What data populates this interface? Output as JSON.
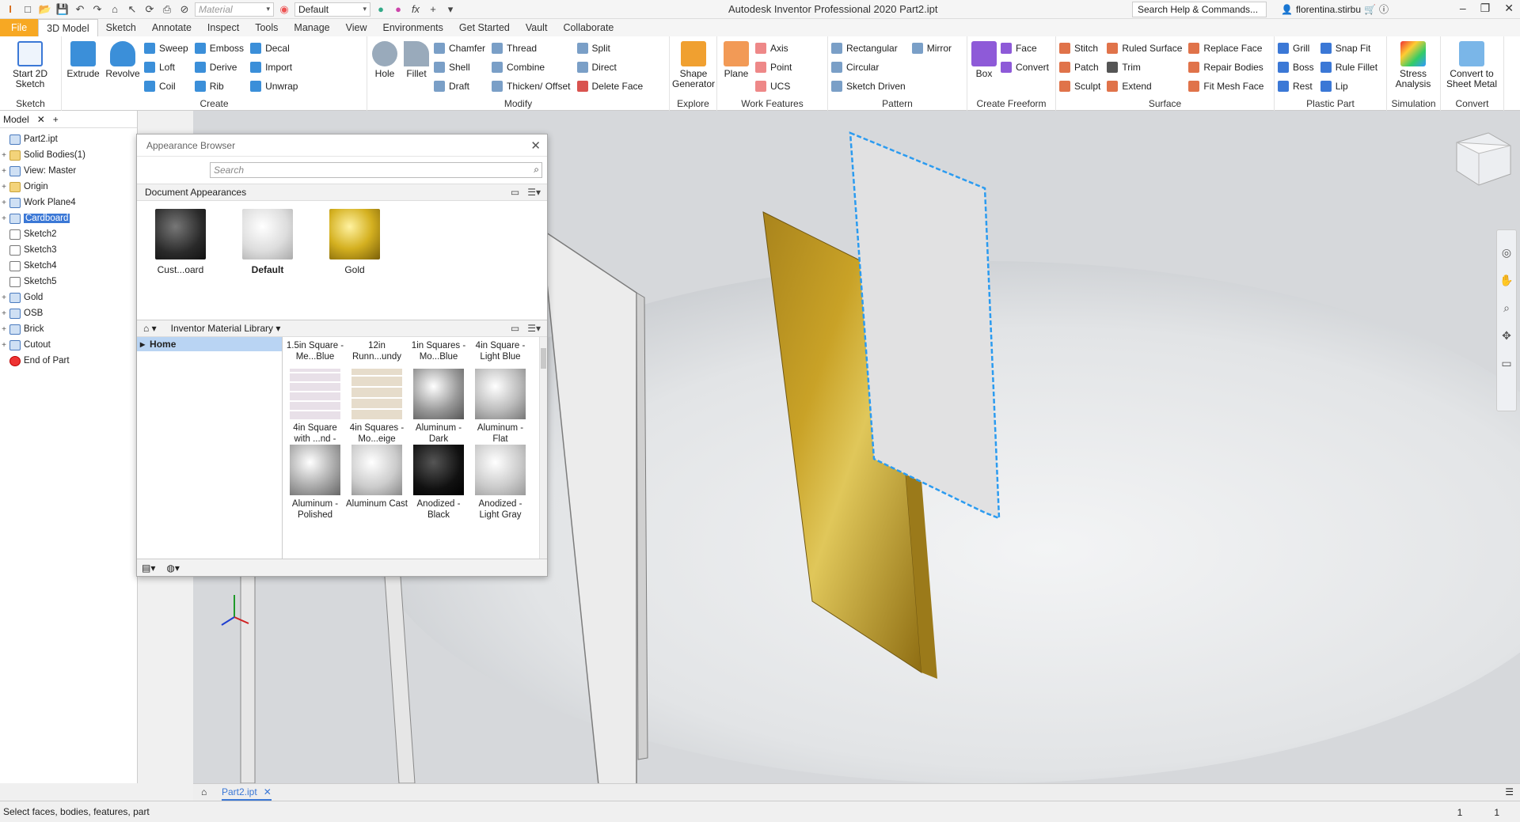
{
  "titlebar": {
    "material_combo": "Material",
    "appearance_combo": "Default",
    "app_title": "Autodesk Inventor Professional 2020   Part2.ipt",
    "search_help": "Search Help & Commands...",
    "user": "florentina.stirbu"
  },
  "menu": {
    "tabs": [
      "File",
      "3D Model",
      "Sketch",
      "Annotate",
      "Inspect",
      "Tools",
      "Manage",
      "View",
      "Environments",
      "Get Started",
      "Vault",
      "Collaborate"
    ]
  },
  "ribbon": {
    "sketch": {
      "big": "Start 2D Sketch",
      "label": "Sketch"
    },
    "create": {
      "big1": "Extrude",
      "big2": "Revolve",
      "col1": [
        "Sweep",
        "Loft",
        "Coil"
      ],
      "col2": [
        "Emboss",
        "Derive",
        "Rib"
      ],
      "col3": [
        "Decal",
        "Import",
        "Unwrap"
      ],
      "label": "Create"
    },
    "modify": {
      "big1": "Hole",
      "big2": "Fillet",
      "col1": [
        "Chamfer",
        "Shell",
        "Draft"
      ],
      "col2": [
        "Thread",
        "Combine",
        "Thicken/ Offset"
      ],
      "col3": [
        "Split",
        "Direct",
        "Delete Face"
      ],
      "label": "Modify"
    },
    "explore": {
      "big": "Shape Generator",
      "label": "Explore"
    },
    "work": {
      "big": "Plane",
      "col1": [
        "Axis",
        "Point",
        "UCS"
      ],
      "label": "Work Features"
    },
    "pattern": {
      "col1": [
        "Rectangular",
        "Circular",
        "Sketch Driven"
      ],
      "col2": [
        "Mirror"
      ],
      "label": "Pattern"
    },
    "freeform": {
      "big": "Box",
      "col1": [
        "Face",
        "Convert"
      ],
      "label": "Create Freeform"
    },
    "surface": {
      "col1": [
        "Stitch",
        "Patch",
        "Sculpt"
      ],
      "col2": [
        "Ruled Surface",
        "Trim",
        "Extend"
      ],
      "col3": [
        "Replace Face",
        "Repair Bodies",
        "Fit Mesh Face"
      ],
      "label": "Surface"
    },
    "plastic": {
      "col1": [
        "Grill",
        "Boss",
        "Rest"
      ],
      "col2": [
        "Snap Fit",
        "Rule Fillet",
        "Lip"
      ],
      "label": "Plastic Part"
    },
    "simulation": {
      "big": "Stress Analysis",
      "label": "Simulation"
    },
    "convert": {
      "big": "Convert to Sheet Metal",
      "label": "Convert"
    }
  },
  "model_browser": {
    "tab": "Model",
    "nodes": [
      {
        "label": "Part2.ipt",
        "type": "part",
        "exp": ""
      },
      {
        "label": "Solid Bodies(1)",
        "type": "folder",
        "exp": "+"
      },
      {
        "label": "View: Master",
        "type": "view",
        "exp": "+"
      },
      {
        "label": "Origin",
        "type": "folder",
        "exp": "+"
      },
      {
        "label": "Work Plane4",
        "type": "plane",
        "exp": "+"
      },
      {
        "label": "Cardboard",
        "type": "feature",
        "exp": "+"
      },
      {
        "label": "Sketch2",
        "type": "sketch",
        "exp": ""
      },
      {
        "label": "Sketch3",
        "type": "sketch",
        "exp": ""
      },
      {
        "label": "Sketch4",
        "type": "sketch",
        "exp": ""
      },
      {
        "label": "Sketch5",
        "type": "sketch",
        "exp": ""
      },
      {
        "label": "Gold",
        "type": "feature",
        "exp": "+"
      },
      {
        "label": "OSB",
        "type": "feature",
        "exp": "+"
      },
      {
        "label": "Brick",
        "type": "feature",
        "exp": "+"
      },
      {
        "label": "Cutout",
        "type": "feature",
        "exp": "+"
      },
      {
        "label": "End of Part",
        "type": "end",
        "exp": ""
      }
    ]
  },
  "appearance_browser": {
    "title": "Appearance Browser",
    "search_placeholder": "Search",
    "doc_section": "Document Appearances",
    "doc_items": [
      "Cust...oard",
      "Default",
      "Gold"
    ],
    "library": "Inventor Material Library",
    "home": "Home",
    "lib_items": [
      "1.5in Square - Me...Blue",
      "12in Runn...undy",
      "1in Squares - Mo...Blue",
      "4in Square - Light Blue",
      "4in Square with ...nd -",
      "4in Squares - Mo...eige",
      "Aluminum - Dark",
      "Aluminum - Flat",
      "Aluminum - Polished",
      "Aluminum Cast",
      "Anodized - Black",
      "Anodized - Light Gray"
    ]
  },
  "document_tab": "Part2.ipt",
  "status": {
    "text": "Select faces, bodies, features, part",
    "n1": "1",
    "n2": "1"
  },
  "colors": {
    "accent": "#3b78d6",
    "file_tab": "#f7a823",
    "gold": "#c9a227"
  }
}
